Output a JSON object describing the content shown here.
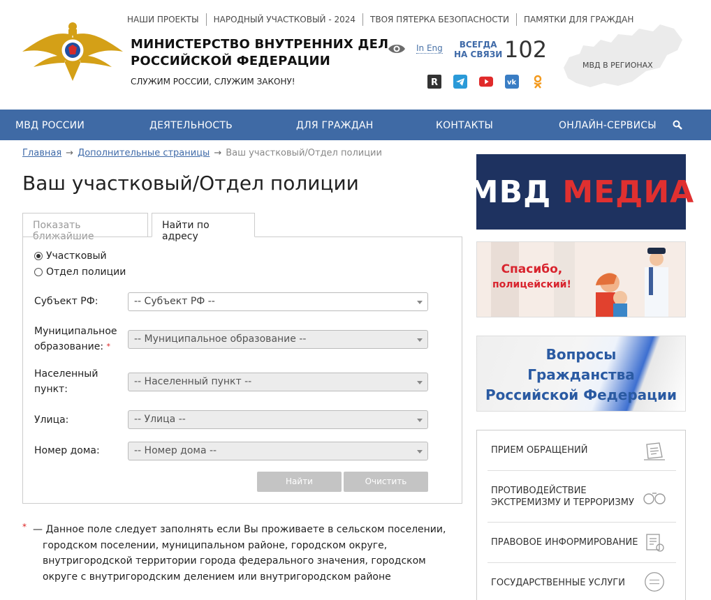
{
  "top_links": [
    "НАШИ ПРОЕКТЫ",
    "НАРОДНЫЙ УЧАСТКОВЫЙ - 2024",
    "ТВОЯ ПЯТЕРКА БЕЗОПАСНОСТИ",
    "ПАМЯТКИ ДЛЯ ГРАЖДАН"
  ],
  "header": {
    "ministry_line1": "МИНИСТЕРСТВО ВНУТРЕННИХ ДЕЛ",
    "ministry_line2": "РОССИЙСКОЙ ФЕДЕРАЦИИ",
    "motto": "СЛУЖИМ РОССИИ, СЛУЖИМ ЗАКОНУ!",
    "lang_link": "In Eng",
    "always_line1": "ВСЕГДА",
    "always_line2": "НА СВЯЗИ",
    "phone": "102",
    "regions": "МВД В РЕГИОНАХ",
    "socials": [
      "rutube-icon",
      "telegram-icon",
      "youtube-icon",
      "vk-icon",
      "ok-icon"
    ]
  },
  "nav": {
    "items": [
      "МВД РОССИИ",
      "ДЕЯТЕЛЬНОСТЬ",
      "ДЛЯ ГРАЖДАН",
      "КОНТАКТЫ",
      "ОНЛАЙН-СЕРВИСЫ"
    ]
  },
  "breadcrumbs": {
    "home": "Главная",
    "extra": "Дополнительные страницы",
    "current": "Ваш участковый/Отдел полиции",
    "separator": "→"
  },
  "page_title": "Ваш участковый/Отдел полиции",
  "tabs": {
    "nearest": "Показать ближайшие",
    "by_address": "Найти по адресу"
  },
  "form": {
    "radio_officer": "Участковый",
    "radio_department": "Отдел полиции",
    "subject_label": "Субъект РФ:",
    "subject_value": "-- Субъект РФ --",
    "municipal_label_1": "Муниципальное",
    "municipal_label_2": "образование:",
    "required_mark": "*",
    "municipal_value": "-- Муниципальное образование --",
    "settlement_label_1": "Населенный",
    "settlement_label_2": "пункт:",
    "settlement_value": "-- Населенный пункт --",
    "street_label": "Улица:",
    "street_value": "-- Улица --",
    "house_label": "Номер дома:",
    "house_value": "-- Номер дома --",
    "find_button": "Найти",
    "clear_button": "Очистить"
  },
  "note": {
    "star": "*",
    "text": "— Данное поле следует заполнять если Вы проживаете в сельском поселении, городском поселении, муниципальном районе, городском округе, внутригородской территории города федерального значения, городском округе с внутригородским делением или внутригородском районе"
  },
  "banners": {
    "media_white": "МВД",
    "media_red": "МЕДИА",
    "thanks_line1": "Спасибо,",
    "thanks_line2": "полицейский!",
    "citizenship_line1": "Вопросы",
    "citizenship_line2": "Гражданства",
    "citizenship_line3": "Российской Федерации"
  },
  "services": [
    {
      "line1": "ПРИЕМ ОБРАЩЕНИЙ",
      "line2": ""
    },
    {
      "line1": "ПРОТИВОДЕЙСТВИЕ",
      "line2": "ЭКСТРЕМИЗМУ И ТЕРРОРИЗМУ"
    },
    {
      "line1": "ПРАВОВОЕ ИНФОРМИРОВАНИЕ",
      "line2": ""
    },
    {
      "line1": "ГОСУДАРСТВЕННЫЕ УСЛУГИ",
      "line2": ""
    }
  ],
  "colors": {
    "nav": "#3f6aa5",
    "link": "#3f6aa8",
    "required": "#dd2222",
    "media_bg": "#1e3260"
  }
}
